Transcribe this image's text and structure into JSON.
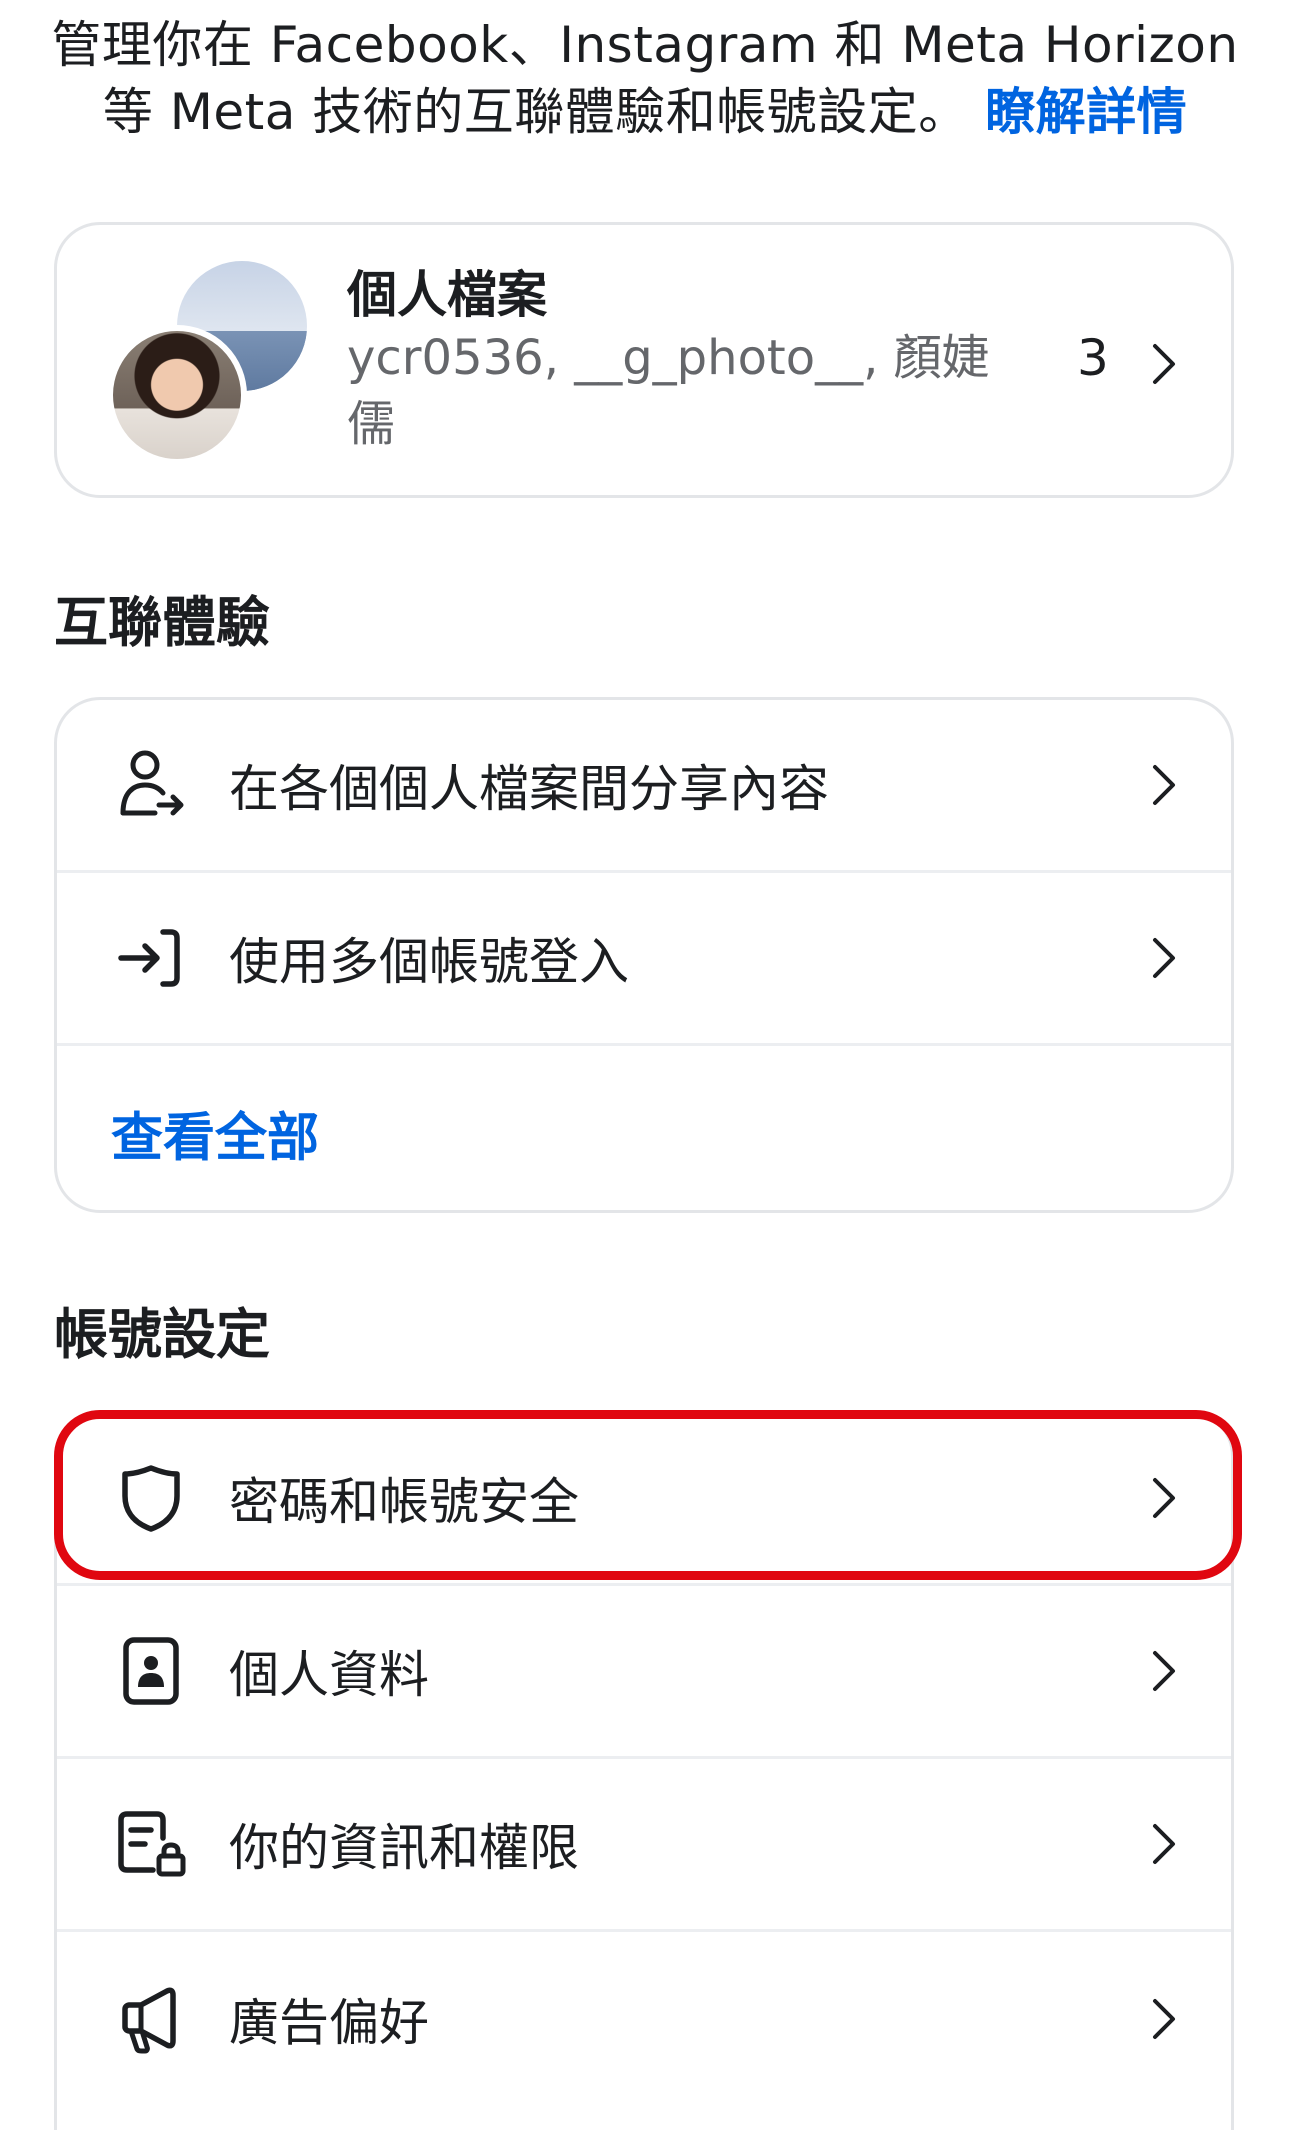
{
  "intro": {
    "text": "管理你在 Facebook、Instagram 和 Meta Horizon 等 Meta 技術的互聯體驗和帳號設定。",
    "learn_more": "瞭解詳情"
  },
  "profile": {
    "title": "個人檔案",
    "names": "ycr0536, __g_photo__, 顏婕儒",
    "count": "3"
  },
  "connected": {
    "section_title": "互聯體驗",
    "items": [
      {
        "label": "在各個個人檔案間分享內容",
        "icon": "person-share-icon"
      },
      {
        "label": "使用多個帳號登入",
        "icon": "login-arrow-icon"
      }
    ],
    "see_all": "查看全部"
  },
  "account": {
    "section_title": "帳號設定",
    "items": [
      {
        "label": "密碼和帳號安全",
        "icon": "shield-icon"
      },
      {
        "label": "個人資料",
        "icon": "id-card-icon"
      },
      {
        "label": "你的資訊和權限",
        "icon": "document-lock-icon"
      },
      {
        "label": "廣告偏好",
        "icon": "megaphone-icon"
      }
    ]
  },
  "colors": {
    "link": "#0064e0",
    "highlight": "#e00710",
    "text": "#1c1e21",
    "secondary": "#65676b"
  }
}
